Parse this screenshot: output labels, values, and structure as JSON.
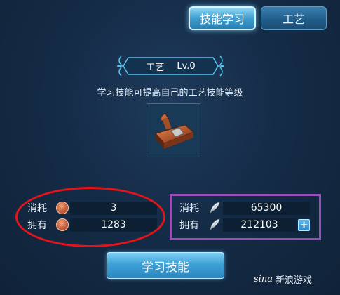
{
  "tabs": [
    {
      "label": "技能学习",
      "active": true
    },
    {
      "label": "工艺",
      "active": false
    }
  ],
  "skill": {
    "name": "工艺",
    "level": "Lv.0",
    "description": "学习技能可提高自己的工艺技能等级"
  },
  "cost_left": {
    "consume_label": "消耗",
    "consume_value": "3",
    "own_label": "拥有",
    "own_value": "1283",
    "icon": "copper-coin-icon"
  },
  "cost_right": {
    "consume_label": "消耗",
    "consume_value": "65300",
    "own_label": "拥有",
    "own_value": "212103",
    "icon": "feather-icon"
  },
  "learn_button": "学习技能",
  "watermark": {
    "logo": "sina",
    "text": "新浪游戏"
  },
  "colors": {
    "annotation_red": "#e5141b",
    "annotation_purple": "#9a4fb7",
    "tab_active": "#3f9fce",
    "background": "#152c47"
  }
}
